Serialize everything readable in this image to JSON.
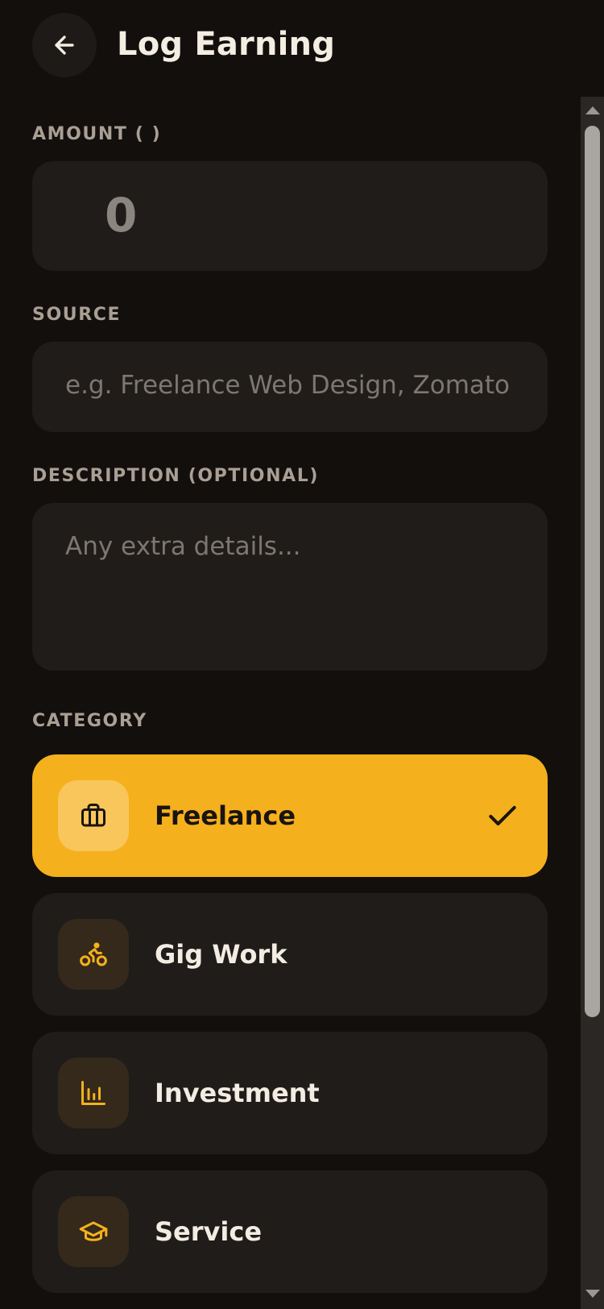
{
  "header": {
    "title": "Log Earning"
  },
  "form": {
    "amount": {
      "label": "AMOUNT (  )",
      "value": "0"
    },
    "source": {
      "label": "SOURCE",
      "placeholder": "e.g. Freelance Web Design, Zomato Delivery"
    },
    "description": {
      "label": "DESCRIPTION (OPTIONAL)",
      "placeholder": "Any extra details..."
    },
    "category": {
      "label": "CATEGORY",
      "items": [
        {
          "label": "Freelance",
          "icon": "briefcase-icon",
          "selected": true
        },
        {
          "label": "Gig Work",
          "icon": "bike-icon",
          "selected": false
        },
        {
          "label": "Investment",
          "icon": "bar-chart-icon",
          "selected": false
        },
        {
          "label": "Service",
          "icon": "graduation-cap-icon",
          "selected": false
        }
      ]
    }
  },
  "colors": {
    "background": "#120f0d",
    "surface": "#1f1c1a",
    "accent": "#f5b01e",
    "label": "#aa9f94"
  }
}
